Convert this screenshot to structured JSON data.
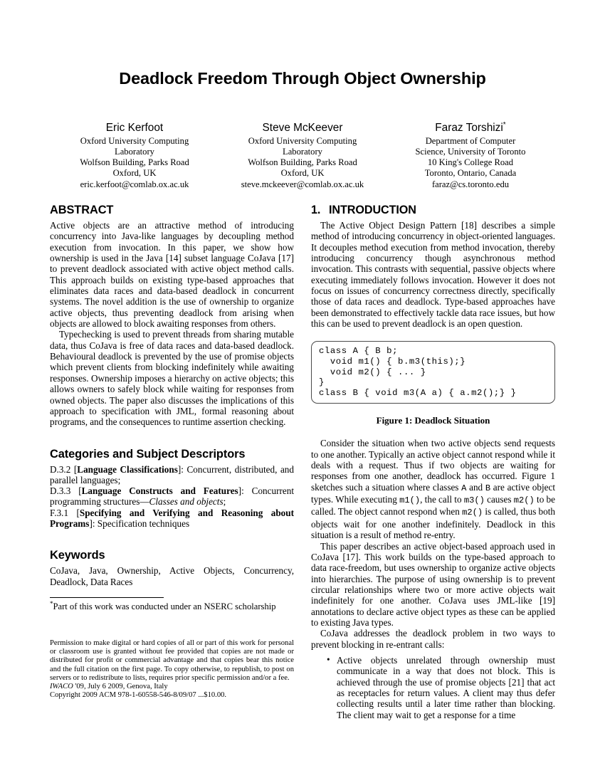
{
  "paper": {
    "title": "Deadlock Freedom Through Object Ownership",
    "authors": [
      {
        "name": "Eric Kerfoot",
        "superscript": "",
        "affiliation": [
          "Oxford University Computing",
          "Laboratory",
          "Wolfson Building, Parks Road",
          "Oxford, UK",
          "eric.kerfoot@comlab.ox.ac.uk"
        ]
      },
      {
        "name": "Steve McKeever",
        "superscript": "",
        "affiliation": [
          "Oxford University Computing",
          "Laboratory",
          "Wolfson Building, Parks Road",
          "Oxford, UK",
          "steve.mckeever@comlab.ox.ac.uk"
        ]
      },
      {
        "name": "Faraz Torshizi",
        "superscript": "*",
        "affiliation": [
          "Department of Computer",
          "Science, University of Toronto",
          "10 King's College Road",
          "Toronto, Ontario, Canada",
          "faraz@cs.toronto.edu"
        ]
      }
    ],
    "abstract": {
      "heading": "ABSTRACT",
      "paragraphs": [
        "Active objects are an attractive method of introducing concurrency into Java-like languages by decoupling method execution from invocation. In this paper, we show how ownership is used in the Java [14] subset language CoJava [17] to prevent deadlock associated with active object method calls. This approach builds on existing type-based approaches that eliminates data races and data-based deadlock in concurrent systems. The novel addition is the use of ownership to organize active objects, thus preventing deadlock from arising when objects are allowed to block awaiting responses from others.",
        "Typechecking is used to prevent threads from sharing mutable data, thus CoJava is free of data races and data-based deadlock. Behavioural deadlock is prevented by the use of promise objects which prevent clients from blocking indefinitely while awaiting responses. Ownership imposes a hierarchy on active objects; this allows owners to safely block while waiting for responses from owned objects. The paper also discusses the implications of this approach to specification with JML, formal reasoning about programs, and the consequences to runtime assertion checking."
      ]
    },
    "categories": {
      "heading": "Categories and Subject Descriptors",
      "entries": [
        {
          "code": "D.3.2",
          "bracket": "Language Classifications",
          "rest": ": Concurrent, distributed, and parallel languages;"
        },
        {
          "code": "D.3.3",
          "bracket": "Language Constructs and Features",
          "rest_pre": ": Concurrent programming structures—",
          "italic": "Classes and objects",
          "rest_post": ";"
        },
        {
          "code": "F.3.1",
          "bracket": "Specifying and Verifying and Reasoning about Programs",
          "rest": ": Specification techniques"
        }
      ]
    },
    "keywords": {
      "heading": "Keywords",
      "text": "CoJava, Java, Ownership, Active Objects, Concurrency, Deadlock, Data Races"
    },
    "footnote": {
      "marker": "*",
      "text": "Part of this work was conducted under an NSERC scholarship"
    },
    "copyright": {
      "permission": "Permission to make digital or hard copies of all or part of this work for personal or classroom use is granted without fee provided that copies are not made or distributed for profit or commercial advantage and that copies bear this notice and the full citation on the first page. To copy otherwise, to republish, to post on servers or to redistribute to lists, requires prior specific permission and/or a fee.",
      "venue_italic": "IWACO",
      "venue_rest": " '09, July 6 2009, Genova, Italy",
      "acm_line": "Copyright 2009 ACM 978-1-60558-546-8/09/07 ...$10.00."
    },
    "introduction": {
      "number": "1.",
      "heading": "INTRODUCTION",
      "para1": "The Active Object Design Pattern [18] describes a simple method of introducing concurrency in object-oriented languages. It decouples method execution from method invocation, thereby introducing concurrency though asynchronous method invocation. This contrasts with sequential, passive objects where executing immediately follows invocation. However it does not focus on issues of concurrency correctness directly, specifically those of data races and deadlock. Type-based approaches have been demonstrated to effectively tackle data race issues, but how this can be used to prevent deadlock is an open question.",
      "para2_part1": "Consider the situation when two active objects send requests to one another. Typically an active object cannot respond while it deals with a request. Thus if two objects are waiting for responses from one another, deadlock has occurred. Figure 1 sketches such a situation where classes ",
      "code_a": "A",
      "para2_part2": " and ",
      "code_b": "B",
      "para2_part3": " are active object types. While executing ",
      "code_m1": "m1()",
      "para2_part4": ", the call to ",
      "code_m3": "m3()",
      "para2_part5": " causes ",
      "code_m2a": "m2()",
      "para2_part6": " to be called. The object cannot respond when ",
      "code_m2b": "m2()",
      "para2_part7": " is called, thus both objects wait for one another indefinitely. Deadlock in this situation is a result of method re-entry.",
      "para3": "This paper describes an active object-based approach used in CoJava [17]. This work builds on the type-based approach to data race-freedom, but uses ownership to organize active objects into hierarchies. The purpose of using ownership is to prevent circular relationships where two or more active objects wait indefinitely for one another. CoJava uses JML-like [19] annotations to declare active object types as these can be applied to existing Java types.",
      "para4": "CoJava addresses the deadlock problem in two ways to prevent blocking in re-entrant calls:",
      "bullets": [
        "Active objects unrelated through ownership must communicate in a way that does not block. This is achieved through the use of promise objects [21] that act as receptacles for return values. A client may thus defer collecting results until a later time rather than blocking. The client may wait to get a response for a time"
      ]
    },
    "figure1": {
      "caption": "Figure 1: Deadlock Situation",
      "code": "class A { B b;\n  void m1() { b.m3(this);}\n  void m2() { ... }\n}\nclass B { void m3(A a) { a.m2();} }"
    }
  }
}
